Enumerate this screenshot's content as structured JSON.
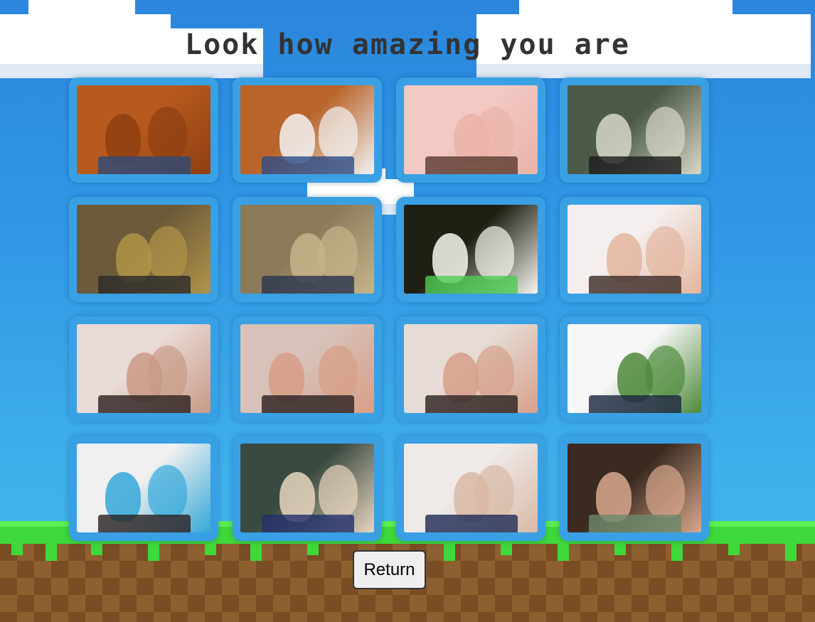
{
  "title": "Look how amazing you are",
  "return_label": "Return",
  "photos": [
    {
      "scene": "elevator-mirror-selfie",
      "colors": [
        "#b85a1e",
        "#8f3f12",
        "#2c4a7a"
      ]
    },
    {
      "scene": "elevator-mirror-selfie",
      "colors": [
        "#b8642a",
        "#f2f2f2",
        "#2d4c86"
      ]
    },
    {
      "scene": "close-up-selfie",
      "colors": [
        "#f3c9c4",
        "#e9b3a8",
        "#5a3a30"
      ]
    },
    {
      "scene": "webcam-portrait",
      "colors": [
        "#4d5a48",
        "#d8d8c8",
        "#1c1c1c"
      ]
    },
    {
      "scene": "statues-grotto",
      "colors": [
        "#6c5a3a",
        "#b09448",
        "#2a2a2a"
      ]
    },
    {
      "scene": "stone-wall-portrait",
      "colors": [
        "#8a7a5a",
        "#c6b48a",
        "#2a3550"
      ]
    },
    {
      "scene": "dark-flash-selfie",
      "colors": [
        "#1f1f14",
        "#f7f7f0",
        "#4ecc52"
      ]
    },
    {
      "scene": "smiling-selfie",
      "colors": [
        "#f4eeee",
        "#e3b59e",
        "#3b2a25"
      ]
    },
    {
      "scene": "two-person-selfie",
      "colors": [
        "#e8dad5",
        "#c99a86",
        "#2a2020"
      ]
    },
    {
      "scene": "two-person-selfie",
      "colors": [
        "#d7c1b8",
        "#d79e86",
        "#2b2020"
      ]
    },
    {
      "scene": "two-person-selfie",
      "colors": [
        "#e6dcd5",
        "#d6a08a",
        "#2a2020"
      ]
    },
    {
      "scene": "outdoor-street",
      "colors": [
        "#f7f7f7",
        "#4d8a3a",
        "#1b2540"
      ]
    },
    {
      "scene": "two-person-selfie",
      "colors": [
        "#f0f0f0",
        "#35a8d8",
        "#2a2020"
      ]
    },
    {
      "scene": "two-person-selfie",
      "colors": [
        "#3a4a40",
        "#e8d6bf",
        "#22306a"
      ]
    },
    {
      "scene": "laptop-screenshot",
      "colors": [
        "#eeeae8",
        "#d9b9a5",
        "#1e2a55"
      ]
    },
    {
      "scene": "restaurant-selfie",
      "colors": [
        "#3a2a20",
        "#d8a88e",
        "#6b8a6a"
      ]
    }
  ]
}
